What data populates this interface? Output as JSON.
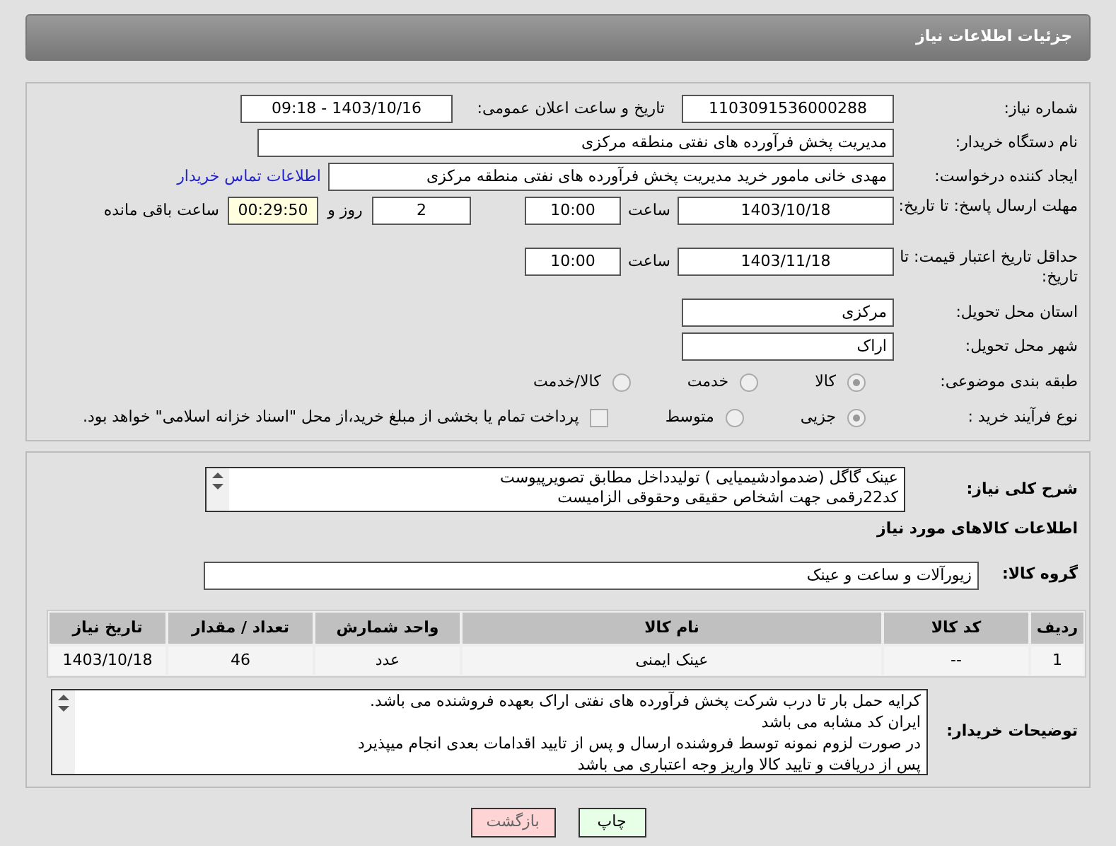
{
  "header": {
    "title": "جزئیات اطلاعات نیاز"
  },
  "need_number": {
    "label": "شماره نیاز:",
    "value": "1103091536000288"
  },
  "announce": {
    "label": "تاریخ و ساعت اعلان عمومی:",
    "value": "1403/10/16 - 09:18"
  },
  "buyer_org": {
    "label": "نام دستگاه خریدار:",
    "value": "مدیریت پخش فرآورده های نفتی منطقه مرکزی"
  },
  "requester": {
    "label": "ایجاد کننده درخواست:",
    "value": "مهدی خانی مامور خرید مدیریت پخش فرآورده های نفتی منطقه مرکزی",
    "link": "اطلاعات تماس خریدار"
  },
  "reply_deadline": {
    "label": "مهلت ارسال پاسخ: تا تاریخ:",
    "date": "1403/10/18",
    "time_label": "ساعت",
    "time": "10:00",
    "days": "2",
    "days_label": "روز و",
    "remaining": "00:29:50",
    "remaining_label": "ساعت باقی مانده"
  },
  "price_validity": {
    "label": "حداقل تاریخ اعتبار قیمت: تا تاریخ:",
    "date": "1403/11/18",
    "time_label": "ساعت",
    "time": "10:00"
  },
  "province": {
    "label": "استان محل تحویل:",
    "value": "مرکزی"
  },
  "city": {
    "label": "شهر محل تحویل:",
    "value": "اراک"
  },
  "category": {
    "label": "طبقه بندی موضوعی:",
    "options": [
      {
        "label": "کالا",
        "selected": true
      },
      {
        "label": "خدمت",
        "selected": false
      },
      {
        "label": "کالا/خدمت",
        "selected": false
      }
    ]
  },
  "process": {
    "label": "نوع فرآیند خرید :",
    "options": [
      {
        "label": "جزیی",
        "selected": true
      },
      {
        "label": "متوسط",
        "selected": false
      }
    ],
    "payment": {
      "label": "پرداخت تمام یا بخشی از مبلغ خرید،از محل \"اسناد خزانه اسلامی\" خواهد بود.",
      "checked": false
    }
  },
  "description": {
    "label": "شرح کلی نیاز:",
    "lines": [
      "عینک گاگل (ضدموادشیمیایی ) تولیدداخل مطابق تصویرپیوست",
      "کد22رقمی  جهت اشخاص حقیقی وحقوقی الزامیست"
    ]
  },
  "goods_heading": "اطلاعات کالاهای مورد نیاز",
  "goods_group": {
    "label": "گروه کالا:",
    "value": "زیورآلات و ساعت و عینک"
  },
  "table": {
    "columns": [
      "ردیف",
      "کد کالا",
      "نام کالا",
      "واحد شمارش",
      "تعداد / مقدار",
      "تاریخ نیاز"
    ],
    "rows": [
      [
        "1",
        "--",
        "عینک ایمنی",
        "عدد",
        "46",
        "1403/10/18"
      ]
    ]
  },
  "buyer_notes": {
    "label": "توضیحات خریدار:",
    "lines": [
      "کرایه حمل بار تا درب شرکت  پخش فرآورده های نفتی اراک بعهده فروشنده می باشد.",
      "ایران کد مشابه می باشد",
      "در صورت لزوم نمونه توسط فروشنده ارسال و پس از تایید اقدامات بعدی انجام میپذیرد",
      "پس از دریافت و تایید کالا واریز وجه اعتباری می باشد"
    ]
  },
  "buttons": [
    {
      "label": "چاپ",
      "kind": "print"
    },
    {
      "label": "بازگشت",
      "kind": "back"
    }
  ]
}
